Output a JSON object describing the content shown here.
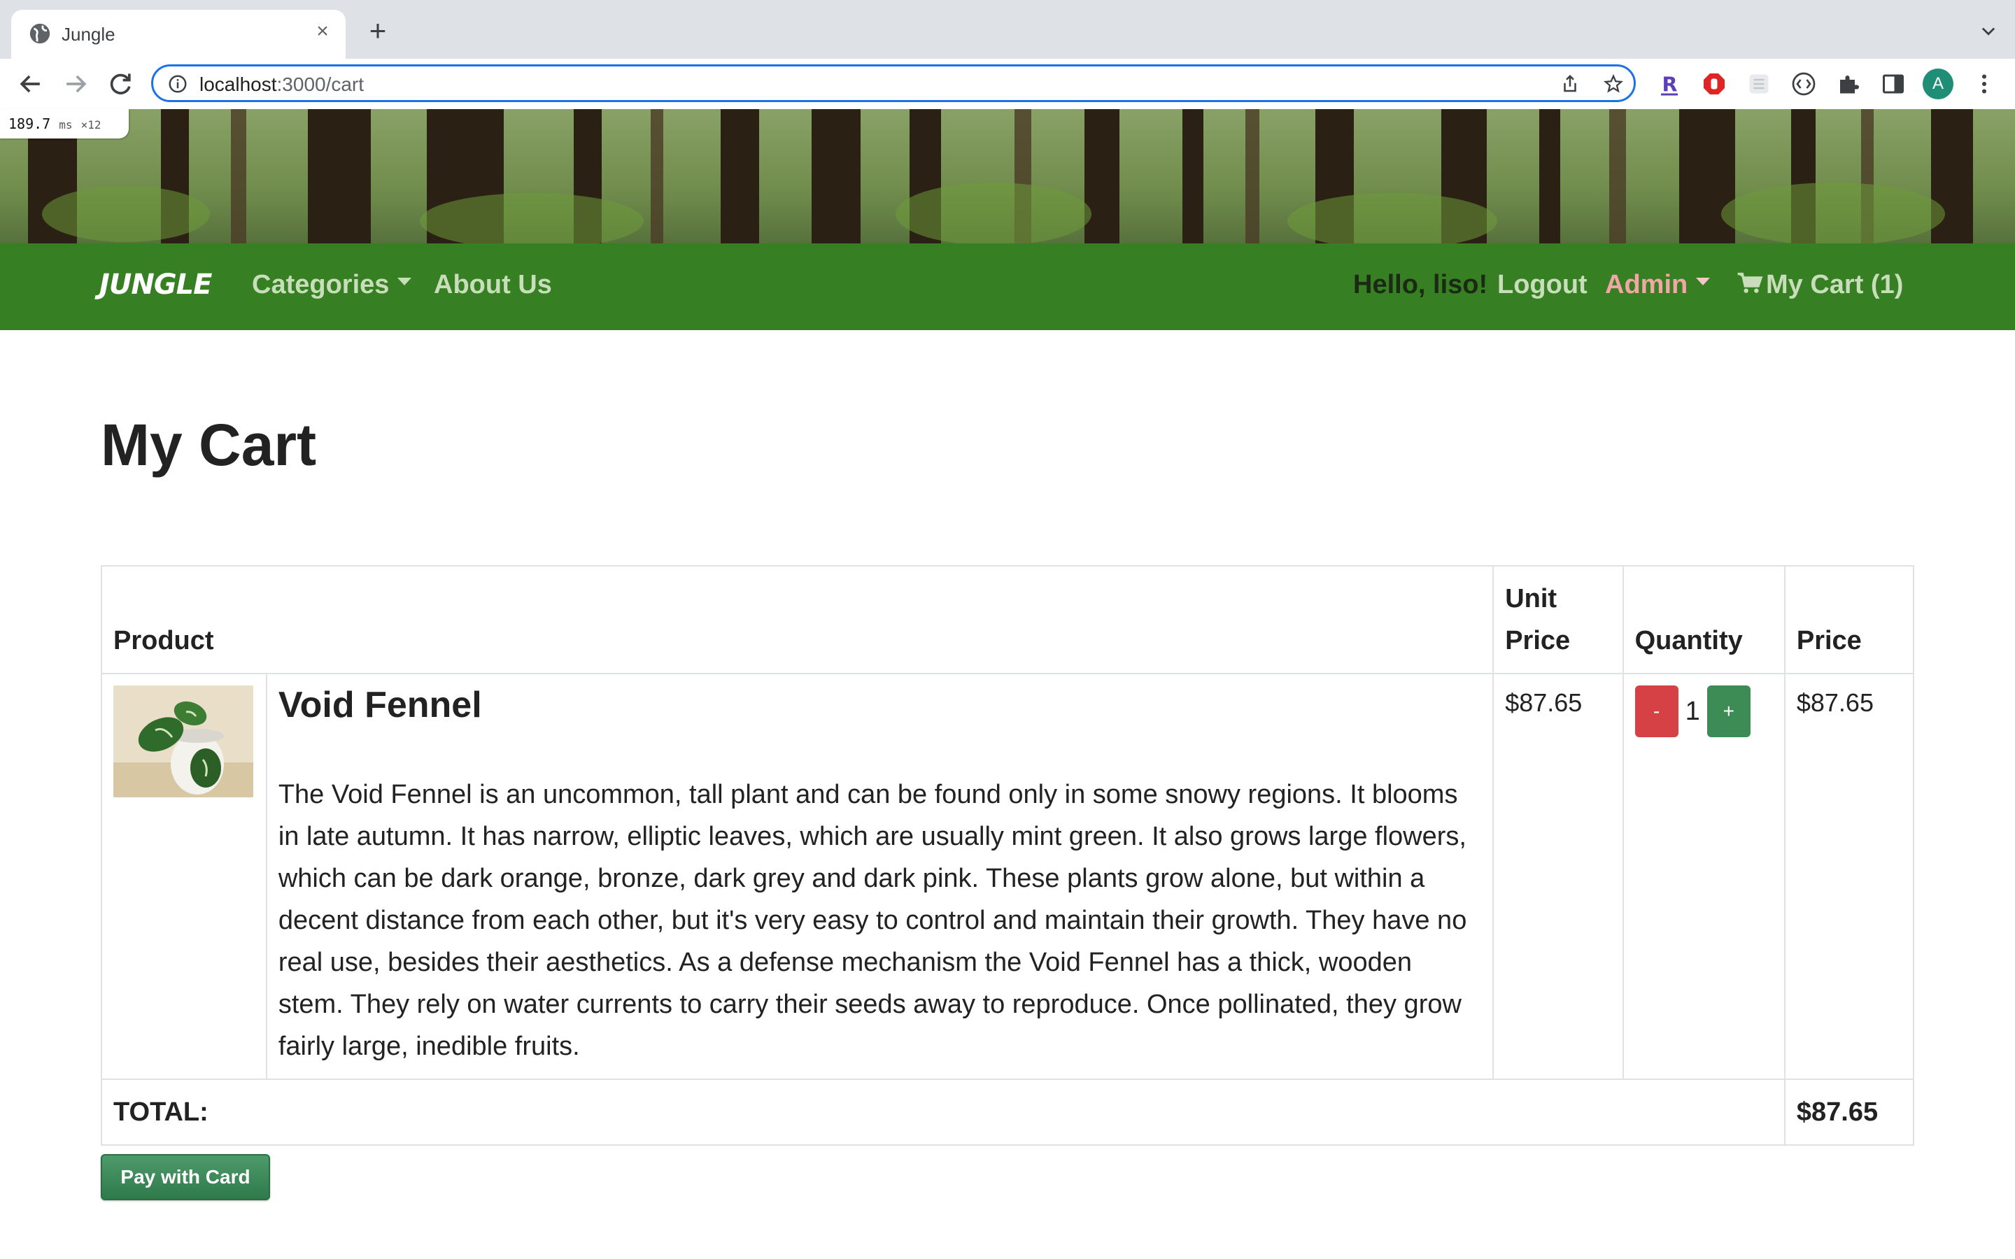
{
  "browser": {
    "tab_title": "Jungle",
    "url_host": "localhost",
    "url_path": ":3000/cart",
    "perf_badge": "189.7",
    "perf_unit": "ms",
    "perf_count": "×12",
    "avatar_letter": "A"
  },
  "nav": {
    "brand": "JUNGLE",
    "categories": "Categories",
    "about": "About Us",
    "greeting": "Hello, liso!",
    "logout": "Logout",
    "admin": "Admin",
    "cart": "My Cart (1)"
  },
  "page": {
    "title": "My Cart"
  },
  "table": {
    "headers": {
      "product": "Product",
      "unit_price": "Unit Price",
      "quantity": "Quantity",
      "price": "Price"
    },
    "items": [
      {
        "name": "Void Fennel",
        "description": "The Void Fennel is an uncommon, tall plant and can be found only in some snowy regions. It blooms in late autumn. It has narrow, elliptic leaves, which are usually mint green. It also grows large flowers, which can be dark orange, bronze, dark grey and dark pink. These plants grow alone, but within a decent distance from each other, but it's very easy to control and maintain their growth. They have no real use, besides their aesthetics. As a defense mechanism the Void Fennel has a thick, wooden stem. They rely on water currents to carry their seeds away to reproduce. Once pollinated, they grow fairly large, inedible fruits.",
        "unit_price": "$87.65",
        "quantity": "1",
        "price": "$87.65",
        "minus_label": "-",
        "plus_label": "+"
      }
    ],
    "total_label": "TOTAL:",
    "total_value": "$87.65"
  },
  "pay_button": "Pay with Card",
  "colors": {
    "navbar": "#367f22",
    "minus_button": "#d64146",
    "plus_button": "#3d8b55",
    "pay_button": "#3d8b55",
    "admin_link": "#f3a6a6"
  }
}
